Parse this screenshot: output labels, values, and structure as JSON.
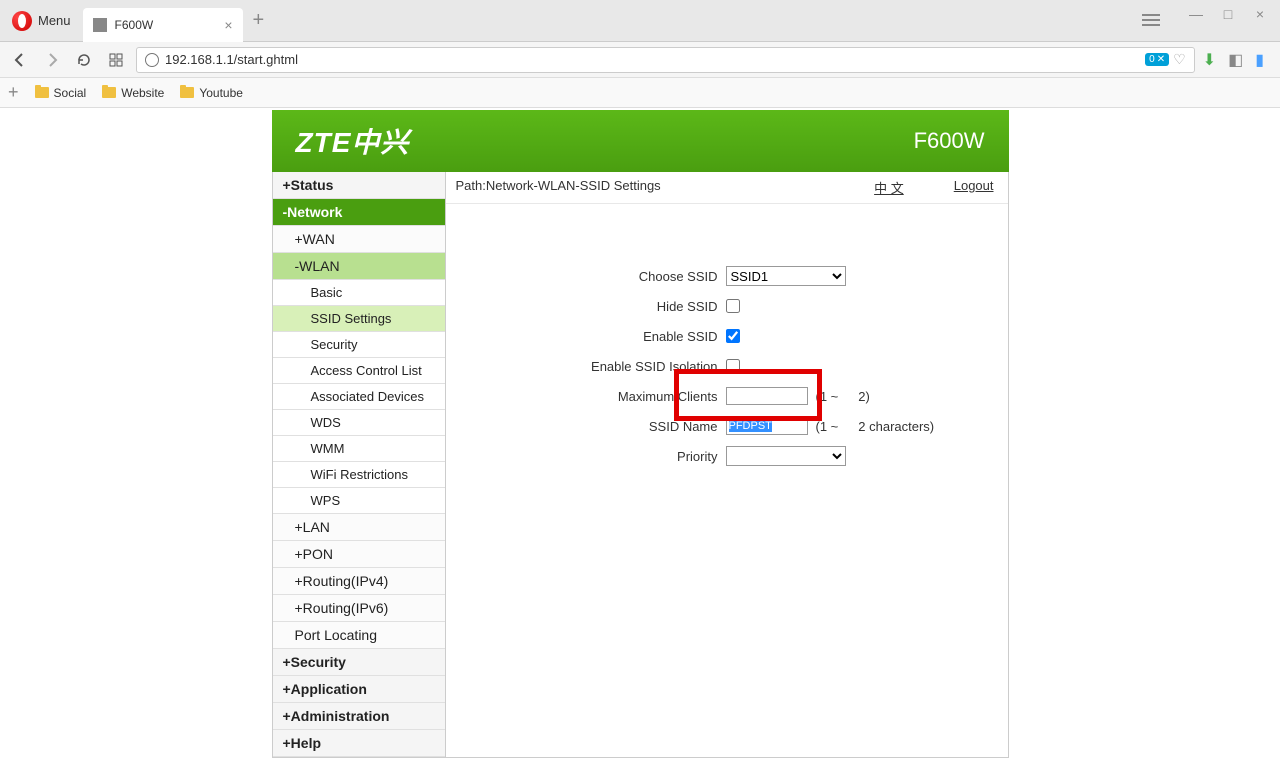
{
  "browser": {
    "menu_label": "Menu",
    "tab_title": "F600W",
    "url": "192.168.1.1/start.ghtml",
    "adblock_count": "0",
    "bookmarks": [
      "Social",
      "Website",
      "Youtube"
    ]
  },
  "header": {
    "logo": "ZTE中兴",
    "model": "F600W"
  },
  "breadcrumb": {
    "path": "Path:Network-WLAN-SSID Settings",
    "lang": "中 文",
    "logout": "Logout"
  },
  "sidebar": {
    "status": "+Status",
    "network": "-Network",
    "wan": "+WAN",
    "wlan": "-WLAN",
    "basic": "Basic",
    "ssid_settings": "SSID Settings",
    "sec": "Security",
    "acl": "Access Control List",
    "assoc": "Associated Devices",
    "wds": "WDS",
    "wmm": "WMM",
    "wifi_restrict": "WiFi Restrictions",
    "wps": "WPS",
    "lan": "+LAN",
    "pon": "+PON",
    "routing4": "+Routing(IPv4)",
    "routing6": "+Routing(IPv6)",
    "port_loc": "Port Locating",
    "security": "+Security",
    "application": "+Application",
    "administration": "+Administration",
    "help": "+Help"
  },
  "form": {
    "choose_ssid_label": "Choose SSID",
    "choose_ssid_value": "SSID1",
    "hide_ssid_label": "Hide SSID",
    "enable_ssid_label": "Enable SSID",
    "enable_isolation_label": "Enable SSID Isolation",
    "max_clients_label": "Maximum Clients",
    "max_clients_hint_left": "(1 ~",
    "max_clients_hint_right": "2)",
    "ssid_name_label": "SSID Name",
    "ssid_name_value": "PFDPST",
    "ssid_name_hint": "(1 ~ 32 characters)",
    "ssid_name_hint_left": "(1 ~",
    "ssid_name_hint_right": "2 characters)",
    "priority_label": "Priority"
  }
}
